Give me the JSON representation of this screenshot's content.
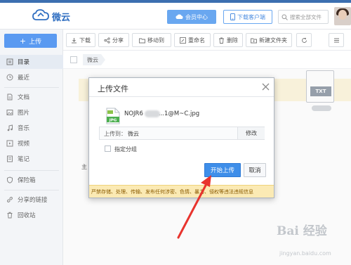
{
  "header": {
    "app_name": "微云",
    "vip_button": "会员中心",
    "download_button": "下载客户端",
    "search_placeholder": "搜索全部文件"
  },
  "sidebar": {
    "upload_label": "上传",
    "items": [
      {
        "label": "目录",
        "icon": "directory-icon"
      },
      {
        "label": "最近",
        "icon": "clock-icon"
      },
      {
        "label": "文档",
        "icon": "document-icon"
      },
      {
        "label": "图片",
        "icon": "image-icon"
      },
      {
        "label": "音乐",
        "icon": "music-icon"
      },
      {
        "label": "视频",
        "icon": "video-icon"
      },
      {
        "label": "笔记",
        "icon": "note-icon"
      },
      {
        "label": "保险箱",
        "icon": "shield-icon"
      },
      {
        "label": "分享的链接",
        "icon": "link-icon"
      },
      {
        "label": "回收站",
        "icon": "trash-icon"
      }
    ]
  },
  "toolbar": {
    "download": "下载",
    "share": "分享",
    "move": "移动到",
    "rename": "重命名",
    "delete": "删除",
    "new_folder": "新建文件夹"
  },
  "breadcrumb": {
    "current": "微云"
  },
  "content": {
    "txt_label": "TXT",
    "partial_text": "主"
  },
  "dialog": {
    "title": "上传文件",
    "file_badge": "JPG",
    "file_name_start": "NOJR6",
    "file_name_end": "...1@M~C.jpg",
    "dest_label": "上传到：",
    "dest_value": "微云",
    "edit_label": "修改",
    "group_label": "指定分组",
    "start_button": "开始上传",
    "cancel_button": "取消",
    "warning": "严禁存储、处理、传输、发布任何涉密、色情、暴力、侵权等违法违规信息"
  },
  "watermark": {
    "text": "Bai 经验",
    "sub": "jingyan.baidu.com"
  },
  "colors": {
    "brand_blue": "#2f6ec1",
    "primary_button": "#3e8ee9",
    "warning_bg": "#fbeab4",
    "arrow_red": "#e8342e"
  }
}
